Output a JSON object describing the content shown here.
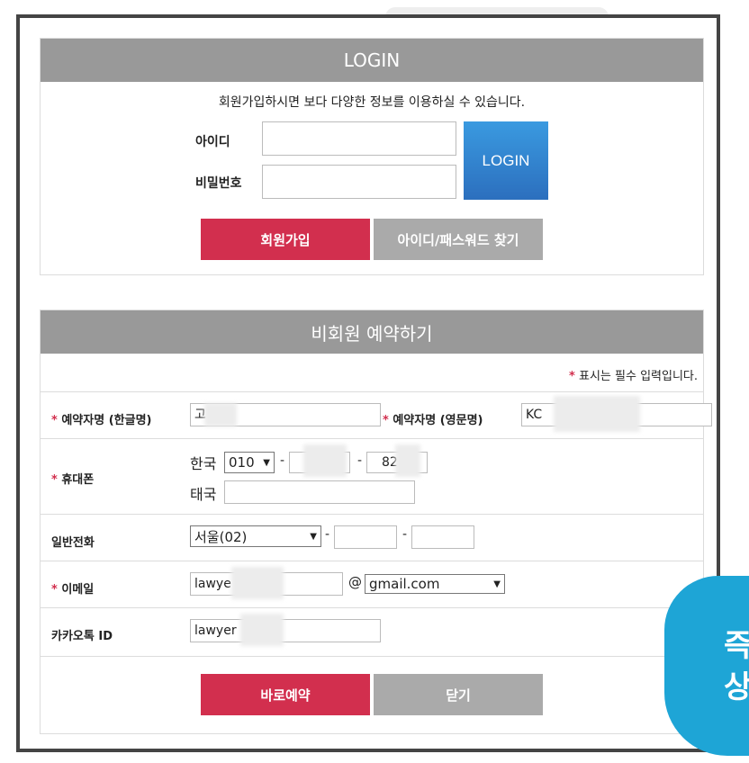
{
  "login": {
    "header": "LOGIN",
    "notice": "회원가입하시면 보다 다양한 정보를 이용하실 수 있습니다.",
    "id_label": "아이디",
    "pw_label": "비밀번호",
    "login_button": "LOGIN",
    "signup_button": "회원가입",
    "find_button": "아이디/패스워드 찾기"
  },
  "reservation": {
    "header": "비회원 예약하기",
    "required_note": "표시는 필수 입력입니다.",
    "required_mark": "*",
    "name_kr_label": "예약자명 (한글명)",
    "name_kr_value": "고",
    "name_en_label": "예약자명 (영문명)",
    "name_en_value": "KC",
    "mobile_label": "휴대폰",
    "korea_label": "한국",
    "mobile_prefix": "010",
    "mobile_last": "82",
    "thai_label": "태국",
    "phone_label": "일반전화",
    "phone_area": "서울(02)",
    "email_label": "이메일",
    "email_local": "lawye",
    "email_at": "@",
    "email_domain": "gmail.com",
    "kakao_label": "카카오톡 ID",
    "kakao_value": "lawyer",
    "dash": "-",
    "reserve_button": "바로예약",
    "close_button": "닫기"
  },
  "sticker": {
    "line1": "즉",
    "line2": "상"
  },
  "colors": {
    "header_gray": "#999999",
    "primary_red": "#d22f4e",
    "login_blue": "#2c6fbe",
    "sticker_blue": "#1ea5d6"
  }
}
